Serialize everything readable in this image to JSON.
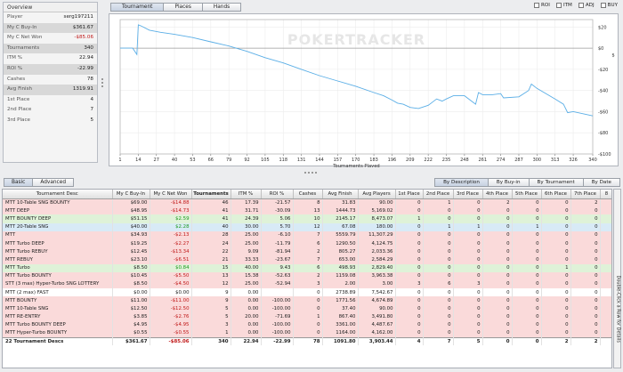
{
  "overview": {
    "title": "Overview",
    "rows": [
      {
        "label": "Player",
        "value": "serg197211",
        "style": "light",
        "color": ""
      },
      {
        "label": "My C Buy-In",
        "value": "$361.67",
        "style": "dark",
        "color": ""
      },
      {
        "label": "My C Net Won",
        "value": "-$85.06",
        "style": "light",
        "color": "red"
      },
      {
        "label": "Tournaments",
        "value": "340",
        "style": "dark",
        "color": ""
      },
      {
        "label": "ITM %",
        "value": "22.94",
        "style": "light",
        "color": ""
      },
      {
        "label": "ROI %",
        "value": "-22.99",
        "style": "dark",
        "color": ""
      },
      {
        "label": "Cashes",
        "value": "78",
        "style": "light",
        "color": ""
      },
      {
        "label": "Avg Finish",
        "value": "1319.91",
        "style": "dark",
        "color": ""
      },
      {
        "label": "1st Place",
        "value": "4",
        "style": "light",
        "color": ""
      },
      {
        "label": "2nd Place",
        "value": "7",
        "style": "light",
        "color": ""
      },
      {
        "label": "3rd Place",
        "value": "5",
        "style": "light",
        "color": ""
      }
    ]
  },
  "top_tabs": [
    "Tournament",
    "Places",
    "Hands"
  ],
  "filters": [
    "ROI",
    "ITM",
    "ADJ",
    "BUY"
  ],
  "watermark": "POKERTRACKER",
  "chart_data": {
    "type": "line",
    "xlabel": "Tournaments Played",
    "ylabel": "$",
    "x_ticks": [
      "1",
      "14",
      "27",
      "40",
      "53",
      "66",
      "79",
      "92",
      "105",
      "118",
      "131",
      "144",
      "157",
      "170",
      "183",
      "196",
      "209",
      "222",
      "235",
      "248",
      "261",
      "274",
      "287",
      "300",
      "313",
      "326",
      "340"
    ],
    "y_ticks": [
      "$20",
      "$0",
      "-$20",
      "-$40",
      "-$60",
      "-$80",
      "-$100"
    ],
    "xlim": [
      1,
      340
    ],
    "ylim": [
      -100,
      27
    ],
    "color": "#5aaee6",
    "x": [
      1,
      10,
      13,
      14,
      16,
      22,
      30,
      40,
      53,
      66,
      79,
      92,
      105,
      118,
      131,
      144,
      157,
      170,
      183,
      190,
      196,
      200,
      204,
      209,
      215,
      222,
      228,
      232,
      235,
      240,
      248,
      256,
      258,
      261,
      268,
      274,
      276,
      287,
      294,
      296,
      300,
      313,
      319,
      322,
      326,
      340
    ],
    "y": [
      0,
      0,
      -6,
      22,
      21,
      17,
      15,
      13,
      10,
      6,
      2,
      -3,
      -9,
      -14,
      -20,
      -26,
      -31,
      -36,
      -42,
      -45,
      -49,
      -52,
      -53,
      -56,
      -57,
      -54,
      -48,
      -50,
      -48,
      -45,
      -45,
      -53,
      -42,
      -44,
      -44,
      -43,
      -47,
      -46,
      -40,
      -34,
      -38,
      -48,
      -53,
      -61,
      -60,
      -64
    ]
  },
  "view_tabs": [
    "Basic",
    "Advanced"
  ],
  "sort_tabs": [
    "By Description",
    "By Buy-in",
    "By Tournament",
    "By Date"
  ],
  "side_tab": "Double-Click a Row for Details",
  "table": {
    "columns": [
      "Tournament Desc",
      "My C Buy-In",
      "My C Net Won",
      "Tournaments",
      "ITM %",
      "ROI %",
      "Cashes",
      "Avg Finish",
      "Avg Players",
      "1st Place",
      "2nd Place",
      "3rd Place",
      "4th Place",
      "5th Place",
      "6th Place",
      "7th Place",
      "8"
    ],
    "rows": [
      {
        "c": "pink",
        "v": [
          "MTT 10-Table SNG BOUNTY",
          "$69.00",
          "-$14.88",
          "46",
          "17.39",
          "-21.57",
          "8",
          "31.83",
          "90.00",
          "0",
          "1",
          "0",
          "2",
          "0",
          "0",
          "2",
          ""
        ]
      },
      {
        "c": "pink",
        "v": [
          "MTT DEEP",
          "$48.95",
          "-$14.73",
          "41",
          "31.71",
          "-30.09",
          "13",
          "1444.73",
          "5,169.02",
          "0",
          "0",
          "0",
          "0",
          "0",
          "0",
          "0",
          ""
        ]
      },
      {
        "c": "green",
        "v": [
          "MTT BOUNTY DEEP",
          "$51.15",
          "$2.59",
          "41",
          "24.39",
          "5.06",
          "10",
          "2145.17",
          "8,473.07",
          "1",
          "0",
          "0",
          "0",
          "0",
          "0",
          "0",
          ""
        ]
      },
      {
        "c": "blue",
        "v": [
          "MTT 20-Table SNG",
          "$40.00",
          "$2.28",
          "40",
          "30.00",
          "5.70",
          "12",
          "67.08",
          "180.00",
          "0",
          "1",
          "1",
          "0",
          "1",
          "0",
          "0",
          ""
        ]
      },
      {
        "c": "pink",
        "v": [
          "MTT",
          "$34.93",
          "-$2.13",
          "28",
          "25.00",
          "-6.10",
          "7",
          "5559.79",
          "11,307.29",
          "0",
          "0",
          "0",
          "0",
          "0",
          "0",
          "0",
          ""
        ]
      },
      {
        "c": "pink",
        "v": [
          "MTT Turbo DEEP",
          "$19.25",
          "-$2.27",
          "24",
          "25.00",
          "-11.79",
          "6",
          "1290.50",
          "4,124.75",
          "0",
          "0",
          "0",
          "0",
          "0",
          "0",
          "0",
          ""
        ]
      },
      {
        "c": "pink",
        "v": [
          "MTT Turbo REBUY",
          "$12.45",
          "-$13.34",
          "22",
          "9.09",
          "-81.94",
          "2",
          "805.27",
          "2,033.36",
          "0",
          "0",
          "0",
          "0",
          "0",
          "0",
          "0",
          ""
        ]
      },
      {
        "c": "pink",
        "v": [
          "MTT REBUY",
          "$23.10",
          "-$6.51",
          "21",
          "33.33",
          "-23.67",
          "7",
          "653.00",
          "2,584.29",
          "0",
          "0",
          "0",
          "0",
          "0",
          "0",
          "0",
          ""
        ]
      },
      {
        "c": "green",
        "v": [
          "MTT Turbo",
          "$8.50",
          "$0.84",
          "15",
          "40.00",
          "9.43",
          "6",
          "498.93",
          "2,829.40",
          "0",
          "0",
          "0",
          "0",
          "0",
          "1",
          "0",
          ""
        ]
      },
      {
        "c": "pink",
        "v": [
          "MTT Turbo BOUNTY",
          "$10.45",
          "-$5.50",
          "13",
          "15.38",
          "-52.63",
          "2",
          "1159.08",
          "3,963.38",
          "0",
          "0",
          "0",
          "0",
          "0",
          "0",
          "0",
          ""
        ]
      },
      {
        "c": "pink",
        "v": [
          "STT (3 max) Hyper-Turbo SNG LOTTERY",
          "$8.50",
          "-$4.50",
          "12",
          "25.00",
          "-52.94",
          "3",
          "2.00",
          "3.00",
          "3",
          "6",
          "3",
          "0",
          "0",
          "0",
          "0",
          ""
        ]
      },
      {
        "c": "",
        "v": [
          "MTT (2 max) FAST",
          "$0.00",
          "$0.00",
          "9",
          "0.00",
          "",
          "0",
          "2738.89",
          "7,542.67",
          "0",
          "0",
          "0",
          "0",
          "0",
          "0",
          "0",
          ""
        ]
      },
      {
        "c": "pink",
        "v": [
          "MTT BOUNTY",
          "$11.00",
          "-$11.00",
          "9",
          "0.00",
          "-100.00",
          "0",
          "1771.56",
          "4,674.89",
          "0",
          "0",
          "0",
          "0",
          "0",
          "0",
          "0",
          ""
        ]
      },
      {
        "c": "pink",
        "v": [
          "MTT 10-Table SNG",
          "$12.50",
          "-$12.50",
          "5",
          "0.00",
          "-100.00",
          "0",
          "37.40",
          "90.00",
          "0",
          "0",
          "0",
          "0",
          "0",
          "0",
          "0",
          ""
        ]
      },
      {
        "c": "pink",
        "v": [
          "MTT RE-ENTRY",
          "$3.85",
          "-$2.76",
          "5",
          "20.00",
          "-71.69",
          "1",
          "867.40",
          "3,491.80",
          "0",
          "0",
          "0",
          "0",
          "0",
          "0",
          "0",
          ""
        ]
      },
      {
        "c": "pink",
        "v": [
          "MTT Turbo BOUNTY DEEP",
          "$4.95",
          "-$4.95",
          "3",
          "0.00",
          "-100.00",
          "0",
          "3361.00",
          "4,487.67",
          "0",
          "0",
          "0",
          "0",
          "0",
          "0",
          "0",
          ""
        ]
      },
      {
        "c": "pink",
        "v": [
          "MTT Hyper-Turbo BOUNTY",
          "$0.55",
          "-$0.55",
          "1",
          "0.00",
          "-100.00",
          "0",
          "1164.00",
          "4,162.00",
          "0",
          "0",
          "0",
          "0",
          "0",
          "0",
          "0",
          ""
        ]
      }
    ],
    "total": [
      "22 Tournament Descs",
      "$361.67",
      "-$85.06",
      "340",
      "22.94",
      "-22.99",
      "78",
      "1091.80",
      "3,903.44",
      "4",
      "7",
      "5",
      "0",
      "0",
      "2",
      "2",
      ""
    ]
  }
}
